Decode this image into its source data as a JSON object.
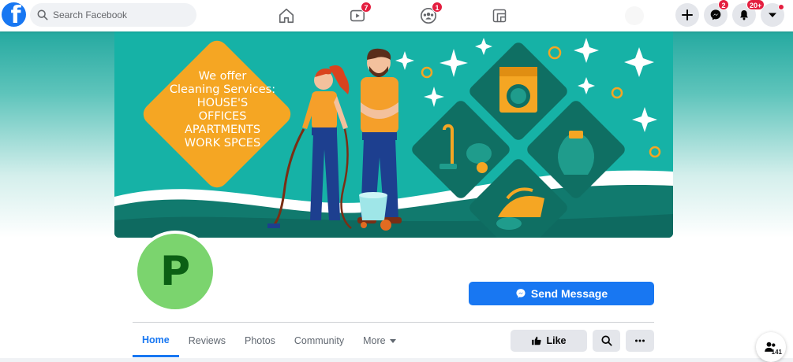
{
  "topnav": {
    "logo": "f",
    "search_placeholder": "Search Facebook",
    "watch_badge": "7",
    "groups_badge": "1",
    "messenger_badge": "2",
    "notifications_badge": "20+"
  },
  "cover": {
    "promo_lines": [
      "We offer",
      "Cleaning Services:",
      "HOUSE'S",
      "OFFICES",
      "APARTMENTS",
      "WORK SPCES"
    ]
  },
  "profile": {
    "avatar_letter": "P"
  },
  "actions": {
    "send_message": "Send Message",
    "like": "Like"
  },
  "tabs": [
    {
      "label": "Home"
    },
    {
      "label": "Reviews"
    },
    {
      "label": "Photos"
    },
    {
      "label": "Community"
    },
    {
      "label": "More"
    }
  ],
  "chat": {
    "count": "141"
  },
  "colors": {
    "brand": "#1877f2",
    "badge": "#e41e3f",
    "cover_teal": "#16b2a6",
    "cover_orange": "#f5a623",
    "avatar_green": "#7bd46e"
  },
  "icons": {
    "home": "home-icon",
    "watch": "video-icon",
    "groups": "groups-icon",
    "gaming": "gaming-icon",
    "create": "plus-icon",
    "messenger": "messenger-icon",
    "notifications": "bell-icon",
    "account": "chevron-down-icon"
  }
}
